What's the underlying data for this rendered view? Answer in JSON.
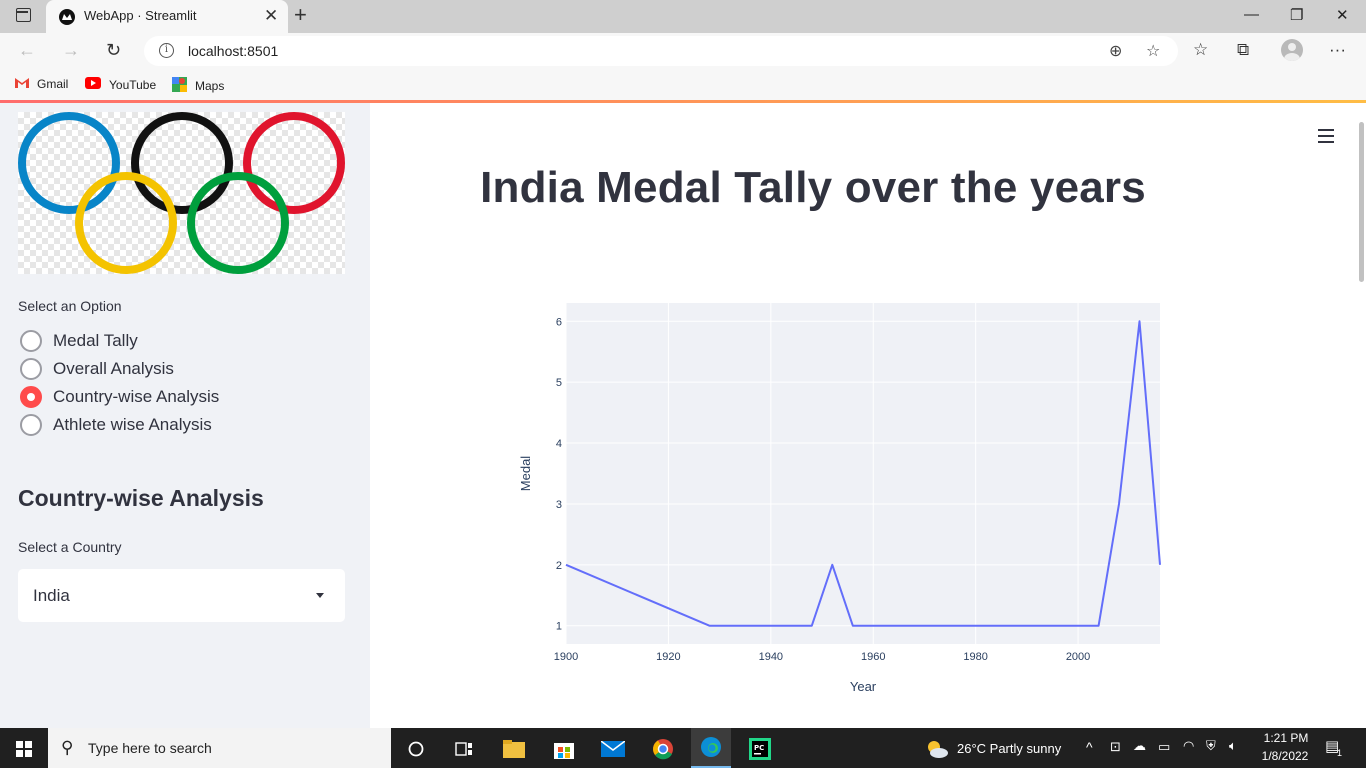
{
  "browser": {
    "tab_title": "WebApp · Streamlit",
    "url": "localhost:8501",
    "bookmarks": [
      {
        "label": "Gmail",
        "icon": "gmail-icon"
      },
      {
        "label": "YouTube",
        "icon": "youtube-icon"
      },
      {
        "label": "Maps",
        "icon": "maps-icon"
      }
    ]
  },
  "sidebar": {
    "option_label": "Select an Option",
    "options": [
      {
        "label": "Medal Tally",
        "selected": false
      },
      {
        "label": "Overall Analysis",
        "selected": false
      },
      {
        "label": "Country-wise Analysis",
        "selected": true
      },
      {
        "label": "Athlete wise Analysis",
        "selected": false
      }
    ],
    "heading": "Country-wise Analysis",
    "country_label": "Select a Country",
    "country_value": "India"
  },
  "main": {
    "title": "India Medal Tally over the years"
  },
  "chart_data": {
    "type": "line",
    "x": [
      1900,
      1928,
      1932,
      1936,
      1948,
      1952,
      1956,
      1964,
      1972,
      1980,
      1984,
      1996,
      2000,
      2004,
      2008,
      2012,
      2016
    ],
    "series": [
      {
        "values": [
          2,
          1,
          1,
          1,
          1,
          2,
          1,
          1,
          1,
          1,
          1,
          1,
          1,
          1,
          3,
          6,
          2
        ]
      }
    ],
    "xlabel": "Year",
    "ylabel": "Medal",
    "xlim": [
      1900,
      2016
    ],
    "ylim": [
      0.7,
      6.3
    ],
    "xticks": [
      "1900",
      "1920",
      "1940",
      "1960",
      "1980",
      "2000"
    ],
    "yticks": [
      "1",
      "2",
      "3",
      "4",
      "5",
      "6"
    ],
    "line_color": "#636efa",
    "plot_bg": "#e5ecf6",
    "grid": true
  },
  "taskbar": {
    "search_placeholder": "Type here to search",
    "weather": "26°C  Partly sunny",
    "time": "1:21 PM",
    "date": "1/8/2022",
    "notification_count": "1"
  },
  "colors": {
    "accent": "#ff4b4b",
    "sidebar_bg": "#f0f2f6",
    "text": "#31333f"
  }
}
